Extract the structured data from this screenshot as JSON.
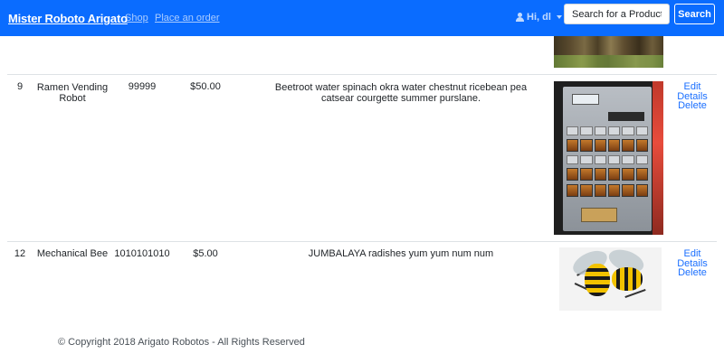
{
  "navbar": {
    "brand": "Mister Roboto Arigato",
    "links": [
      "Shop",
      "Place an order"
    ],
    "user_greeting": "Hi, dl",
    "search_placeholder": "Search for a Product",
    "search_button": "Search",
    "color": "#0a6cff"
  },
  "products": {
    "rows": [
      {
        "id": "9",
        "name": "Ramen Vending Robot",
        "sku": "99999",
        "price": "$50.00",
        "description": "Beetroot water spinach okra water chestnut ricebean pea catsear courgette summer purslane.",
        "image": "ramen-vending-machine",
        "actions": [
          "Edit",
          "Details",
          "Delete"
        ]
      },
      {
        "id": "12",
        "name": "Mechanical Bee",
        "sku": "1010101010",
        "price": "$5.00",
        "description": "JUMBALAYA radishes yum yum num num",
        "image": "mechanical-bee",
        "actions": [
          "Edit",
          "Details",
          "Delete"
        ]
      }
    ]
  },
  "footer": {
    "copyright": "© Copyright 2018 Arigato Robotos - All Rights Reserved"
  }
}
